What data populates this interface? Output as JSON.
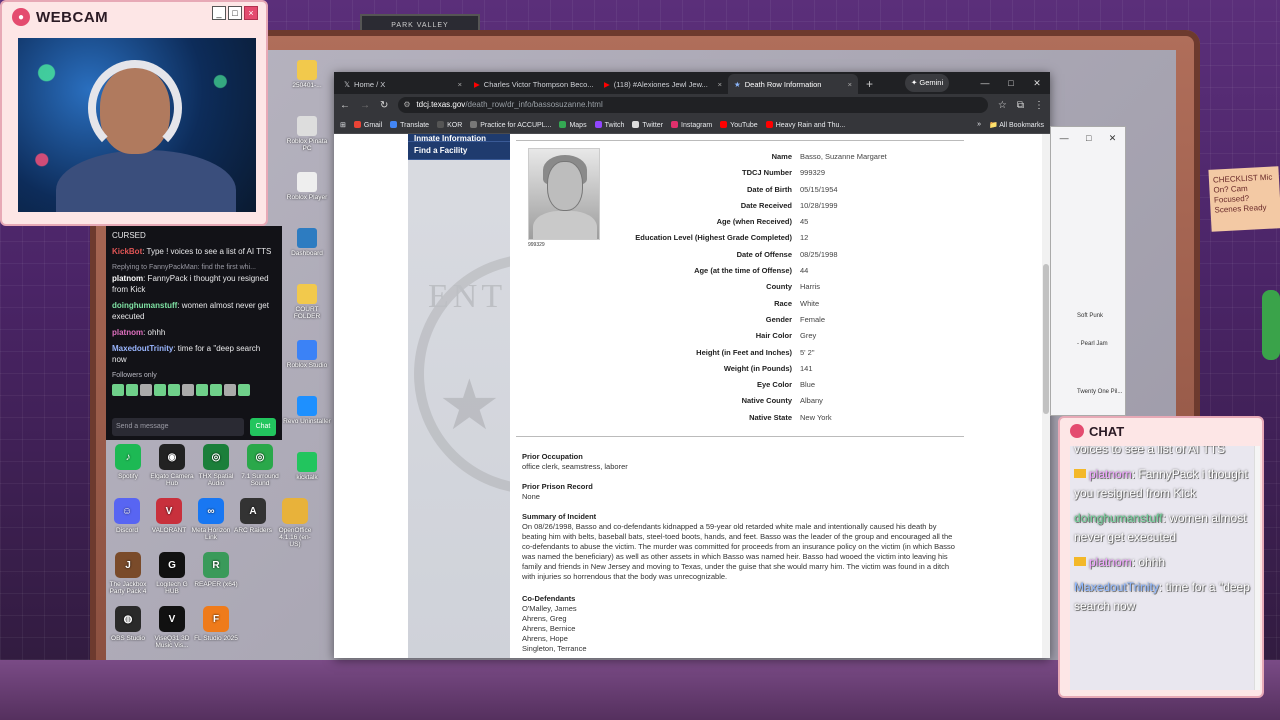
{
  "scene": {
    "shelf_label": "PARK VALLEY",
    "sticky_note": "CHECKLIST Mic On? Cam Focused? Scenes Ready"
  },
  "webcam": {
    "title": "WEBCAM"
  },
  "twitch_chat": {
    "messages": [
      {
        "user": "",
        "text": "CURSED"
      },
      {
        "user": "KickBot",
        "text": ": Type ! voices to see a list of AI TTS"
      },
      {
        "reply": "Replying to FannyPackMan: find the first whi...",
        "user": "platnom",
        "text": ": FannyPack i thought you resigned from Kick"
      },
      {
        "user": "doinghumanstuff",
        "text": ": women almost never get executed"
      },
      {
        "user": "platnom",
        "text": ": ohhh"
      },
      {
        "user": "MaxedoutTrinity",
        "text": ": time for a \"deep search now"
      }
    ],
    "followers_only": "Followers only",
    "input_placeholder": "Send a message",
    "chat_button": "Chat"
  },
  "desktop": {
    "side_icons": [
      "250401-...",
      "Roblox Pinata PC",
      "Roblox Player",
      "Dashboard",
      "COURT FOLDER",
      "Roblox Studio",
      "Revo Uninstaller",
      "kicktalk"
    ],
    "grid_apps": [
      [
        {
          "label": "Spotify",
          "color": "#1db954"
        },
        {
          "label": "Elgato Camera Hub",
          "color": "#222"
        },
        {
          "label": "THX Spatial Audio",
          "color": "#1b7f3a"
        },
        {
          "label": "7.1 Surround Sound",
          "color": "#2aa84a"
        }
      ],
      [
        {
          "label": "Discord",
          "color": "#5865f2"
        },
        {
          "label": "VALORANT",
          "color": "#c8303c"
        },
        {
          "label": "Meta Horizon Link",
          "color": "#1877f2"
        },
        {
          "label": "ARC Raiders",
          "color": "#333"
        },
        {
          "label": "OpenOffice 4.1.16 (en-US)",
          "color": "#e8b23a"
        }
      ],
      [
        {
          "label": "The Jackbox Party Pack 4",
          "color": "#7a4b2a"
        },
        {
          "label": "Logitech G HUB",
          "color": "#111"
        },
        {
          "label": "REAPER (x64)",
          "color": "#3a9a5a"
        }
      ],
      [
        {
          "label": "OBS Studio",
          "color": "#2a2a2a"
        },
        {
          "label": "ViseQ31 3D Music Vis...",
          "color": "#111"
        },
        {
          "label": "FL Studio 2025",
          "color": "#ef7b1a"
        }
      ]
    ]
  },
  "browser": {
    "tabs": [
      {
        "icon": "x-logo-icon",
        "label": "Home / X"
      },
      {
        "icon": "youtube-icon",
        "label": "Charles Victor Thompson Beco..."
      },
      {
        "icon": "youtube-icon",
        "label": "(118) #Alexiones Jewl Jew..."
      },
      {
        "icon": "star-icon",
        "label": "Death Row Information"
      }
    ],
    "gemini_label": "Gemini",
    "url_host": "tdcj.texas.gov",
    "url_path": "/death_row/dr_info/bassosuzanne.html",
    "bookmarks": [
      {
        "label": "Gmail",
        "color": "#ea4335"
      },
      {
        "label": "Translate",
        "color": "#4285f4"
      },
      {
        "label": "KOR",
        "color": "#555"
      },
      {
        "label": "Practice for ACCUPL...",
        "color": "#777"
      },
      {
        "label": "Maps",
        "color": "#34a853"
      },
      {
        "label": "Twitch",
        "color": "#9146ff"
      },
      {
        "label": "Twitter",
        "color": "#ddd"
      },
      {
        "label": "Instagram",
        "color": "#e1306c"
      },
      {
        "label": "YouTube",
        "color": "#ff0000"
      },
      {
        "label": "Heavy Rain and Thu...",
        "color": "#ff0000"
      }
    ],
    "all_bookmarks": "All Bookmarks"
  },
  "page": {
    "nav": [
      "Inmate Information",
      "Find a Facility"
    ],
    "mugshot_number": "999329",
    "inmate_info": [
      {
        "label": "Name",
        "value": "Basso, Suzanne Margaret"
      },
      {
        "label": "TDCJ Number",
        "value": "999329"
      },
      {
        "label": "Date of Birth",
        "value": "05/15/1954"
      },
      {
        "label": "Date Received",
        "value": "10/28/1999"
      },
      {
        "label": "Age (when Received)",
        "value": "45"
      },
      {
        "label": "Education Level (Highest Grade Completed)",
        "value": "12"
      },
      {
        "label": "Date of Offense",
        "value": "08/25/1998"
      },
      {
        "label": "Age (at the time of Offense)",
        "value": "44"
      },
      {
        "label": "County",
        "value": "Harris"
      },
      {
        "label": "Race",
        "value": "White"
      },
      {
        "label": "Gender",
        "value": "Female"
      },
      {
        "label": "Hair Color",
        "value": "Grey"
      },
      {
        "label": "Height (in Feet and Inches)",
        "value": "5' 2\""
      },
      {
        "label": "Weight (in Pounds)",
        "value": "141"
      },
      {
        "label": "Eye Color",
        "value": "Blue"
      },
      {
        "label": "Native County",
        "value": "Albany"
      },
      {
        "label": "Native State",
        "value": "New York"
      }
    ],
    "prior_occupation_title": "Prior Occupation",
    "prior_occupation": "office clerk, seamstress, laborer",
    "prior_record_title": "Prior Prison Record",
    "prior_record": "None",
    "summary_title": "Summary of Incident",
    "summary": "On 08/26/1998, Basso and co-defendants kidnapped a 59-year old retarded white male and intentionally caused his death by beating him with belts, baseball bats, steel-toed boots, hands, and feet. Basso was the leader of the group and encouraged all the co-defendants to abuse the victim. The murder was committed for proceeds from an insurance policy on the victim (in which Basso was named the beneficiary) as well as other assets in which Basso was named heir. Basso had wooed the victim into leaving his family and friends in New Jersey and moving to Texas, under the guise that she would marry him. The victim was found in a ditch with injuries so horrendous that the body was unrecognizable.",
    "codefendants_title": "Co-Defendants",
    "codefendants": [
      "O'Malley, James",
      "Ahrens, Greg",
      "Ahrens, Bernice",
      "Ahrens, Hope",
      "Singleton, Terrance"
    ]
  },
  "bg_window": {
    "items": [
      "Soft Punk",
      "- Pearl Jam",
      "Twenty One Pil..."
    ]
  },
  "chat_overlay": {
    "title": "CHAT",
    "lines": [
      {
        "user": "",
        "text": "voices to see a list of AI TTS"
      },
      {
        "user": "platnom",
        "text": ": FannyPack i thought you resigned from Kick"
      },
      {
        "user": "doinghumanstuff",
        "text": ": women almost never get executed"
      },
      {
        "user": "platnom",
        "text": ": ohhh"
      },
      {
        "user": "MaxedoutTrinity",
        "text": ": time for a \"deep search now"
      }
    ]
  }
}
